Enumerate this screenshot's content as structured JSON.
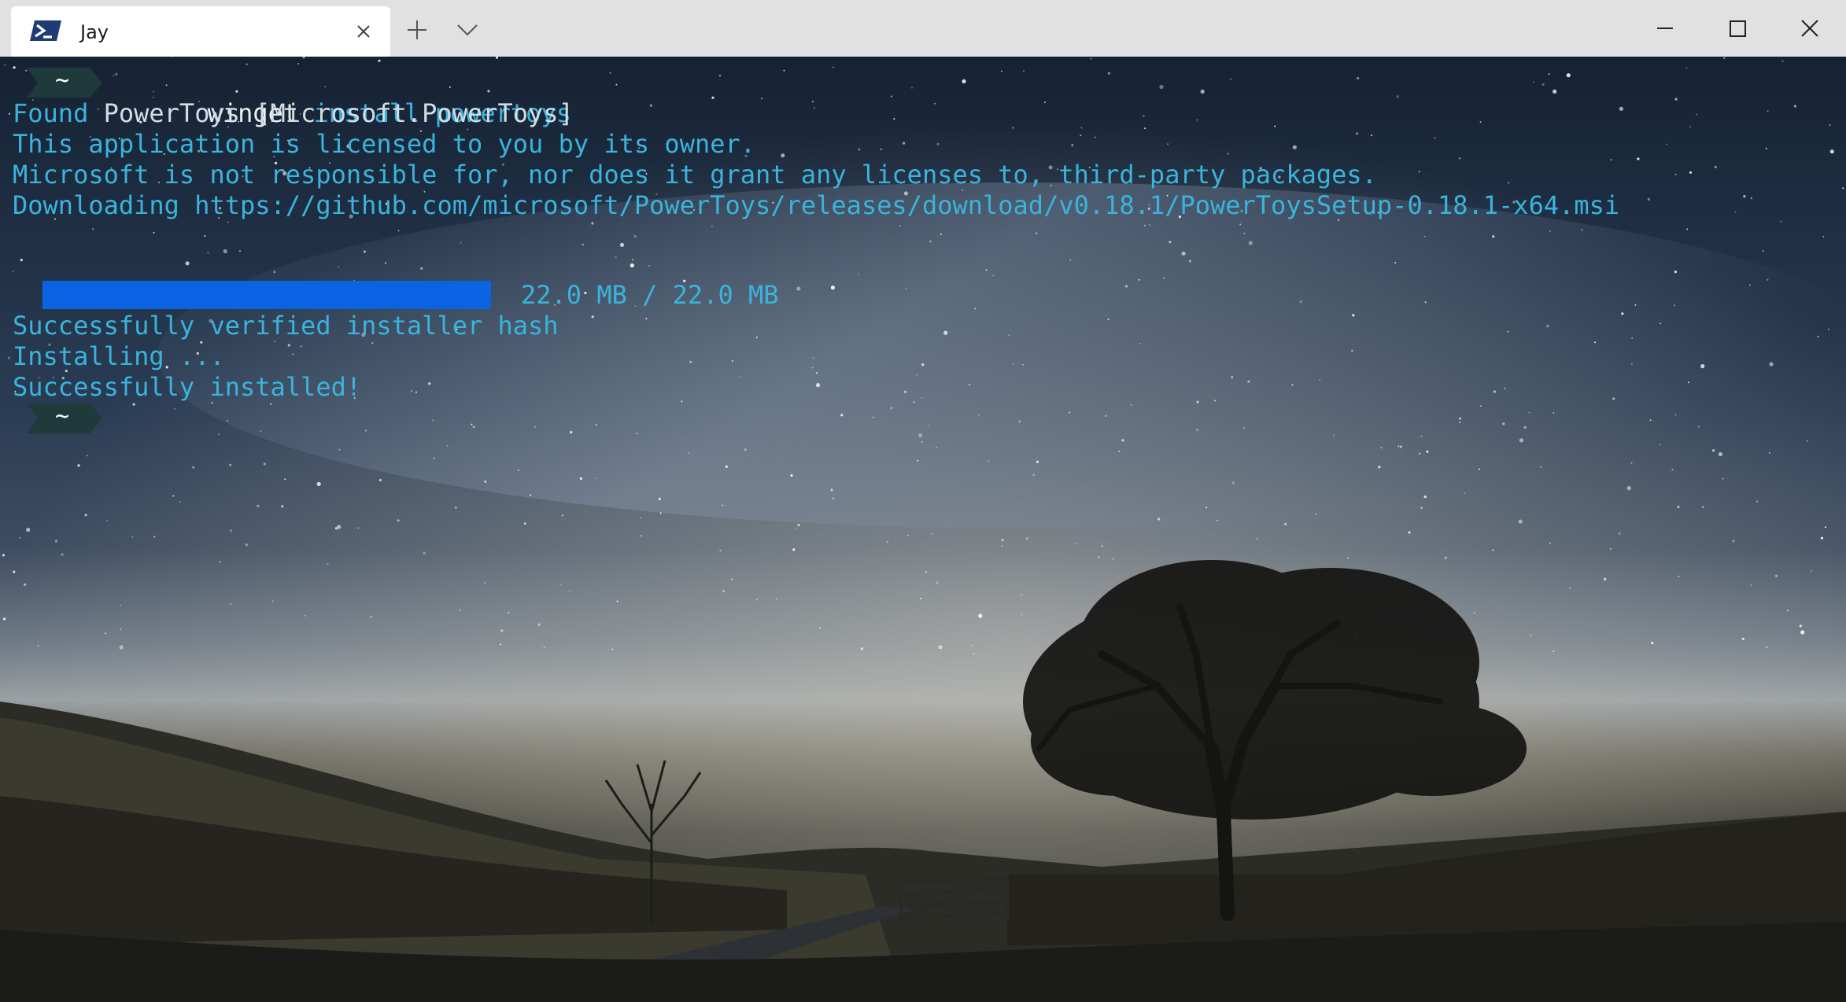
{
  "window": {
    "tab_title": "Jay",
    "tab_icon": "powershell-icon",
    "controls": [
      "minimize-icon",
      "maximize-icon",
      "close-icon"
    ]
  },
  "terminal": {
    "prompt_symbol": "~",
    "command": {
      "program": "winget",
      "args": "install powertoys"
    },
    "found_line": {
      "prefix": "Found ",
      "name": "PowerToys",
      "id": "[Microsoft.PowerToys]"
    },
    "license_line": "This application is licensed to you by its owner.",
    "responsibility_line": "Microsoft is not responsible for, nor does it grant any licenses to, third-party packages.",
    "downloading_line": "Downloading https://github.com/microsoft/PowerToys/releases/download/v0.18.1/PowerToysSetup-0.18.1-x64.msi",
    "progress": {
      "fraction": 1.0,
      "text": "22.0 MB / 22.0 MB"
    },
    "verified_line": "Successfully verified installer hash",
    "installing_line": "Installing ...",
    "installed_line": "Successfully installed!"
  },
  "colors": {
    "terminal_text": "#3ab4dc",
    "command_text": "#e8eef2",
    "prompt_bg": "#1e3a3a",
    "progress_bar": "#0a63e0",
    "titlebar_bg": "#e1e1e1",
    "tab_bg": "#ffffff"
  }
}
